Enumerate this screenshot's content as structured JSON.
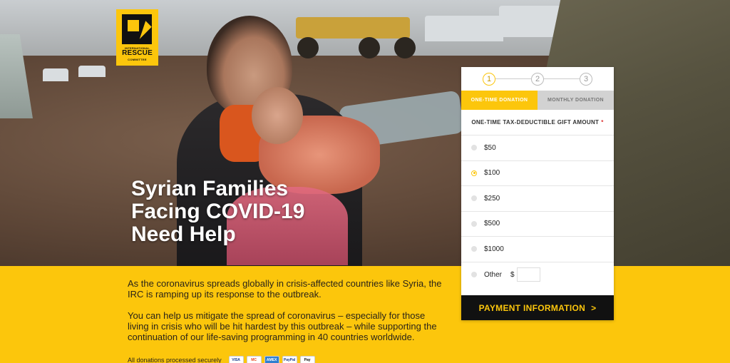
{
  "logo": {
    "line1": "INTERNATIONAL",
    "line2": "RESCUE",
    "line3": "COMMITTEE"
  },
  "headline": {
    "line1": "Syrian Families",
    "line2": "Facing COVID-19",
    "line3": "Need Help"
  },
  "body": {
    "p1": "As the coronavirus spreads globally in crisis-affected countries like Syria, the IRC is ramping up its response to the outbreak.",
    "p2": "You can help us mitigate the spread of coronavirus – especially for those living in crisis who will be hit hardest by this outbreak – while supporting the continuation of our life-saving programming in 40 countries worldwide."
  },
  "secure": {
    "label": "All donations processed securely",
    "cards": [
      "VISA",
      "MC",
      "AMEX",
      "PayPal",
      "Pay"
    ]
  },
  "form": {
    "steps": [
      "1",
      "2",
      "3"
    ],
    "tabs": {
      "one_time": "ONE-TIME DONATION",
      "monthly": "MONTHLY DONATION"
    },
    "gift_label": "ONE-TIME TAX-DEDUCTIBLE GIFT AMOUNT",
    "required_mark": "*",
    "options": [
      "$50",
      "$100",
      "$250",
      "$500",
      "$1000"
    ],
    "selected": "$100",
    "other_label": "Other",
    "other_currency": "$",
    "other_value": "",
    "button": "PAYMENT INFORMATION",
    "button_arrow": ">"
  },
  "colors": {
    "brand_yellow": "#fcc60c",
    "button_bg": "#111111"
  }
}
